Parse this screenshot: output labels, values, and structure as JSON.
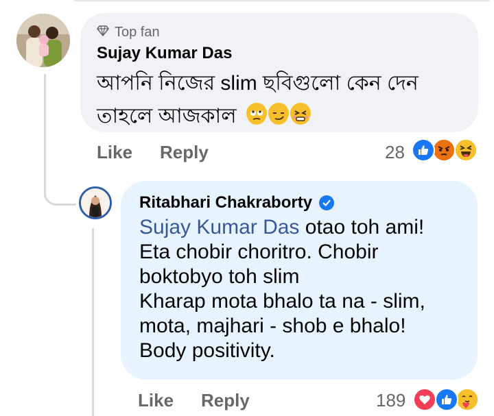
{
  "comment": {
    "badge": "Top fan",
    "author": "Sujay Kumar Das",
    "text_line1": "আপনি নিজের slim ছবিগুলো কেন দেন",
    "text_line2": "তাহলে আজকাল",
    "emojis": [
      "rolling-eyes-icon",
      "smirk-icon",
      "persevering-icon"
    ],
    "actions": {
      "like": "Like",
      "reply": "Reply"
    },
    "reaction_count": "28",
    "reactions": [
      "like-icon",
      "angry-icon",
      "laughing-icon"
    ]
  },
  "reply": {
    "author": "Ritabhari Chakraborty",
    "verified": true,
    "mention": "Sujay Kumar Das",
    "text_after_mention": " otao toh ami!",
    "lines": [
      "Eta chobir choritro. Chobir",
      "boktobyo toh slim",
      "Kharap mota bhalo ta na - slim,",
      "mota, majhari - shob e bhalo!",
      "Body positivity."
    ],
    "actions": {
      "like": "Like",
      "reply": "Reply"
    },
    "reaction_count": "189",
    "reactions": [
      "love-icon",
      "like-icon",
      "care-icon"
    ]
  },
  "colors": {
    "comment_bubble": "#f0f2f5",
    "reply_bubble": "#e7f3ff",
    "mention": "#385898",
    "meta_text": "#65676b",
    "like_blue": "#1877f2",
    "love_red": "#f33e58"
  }
}
